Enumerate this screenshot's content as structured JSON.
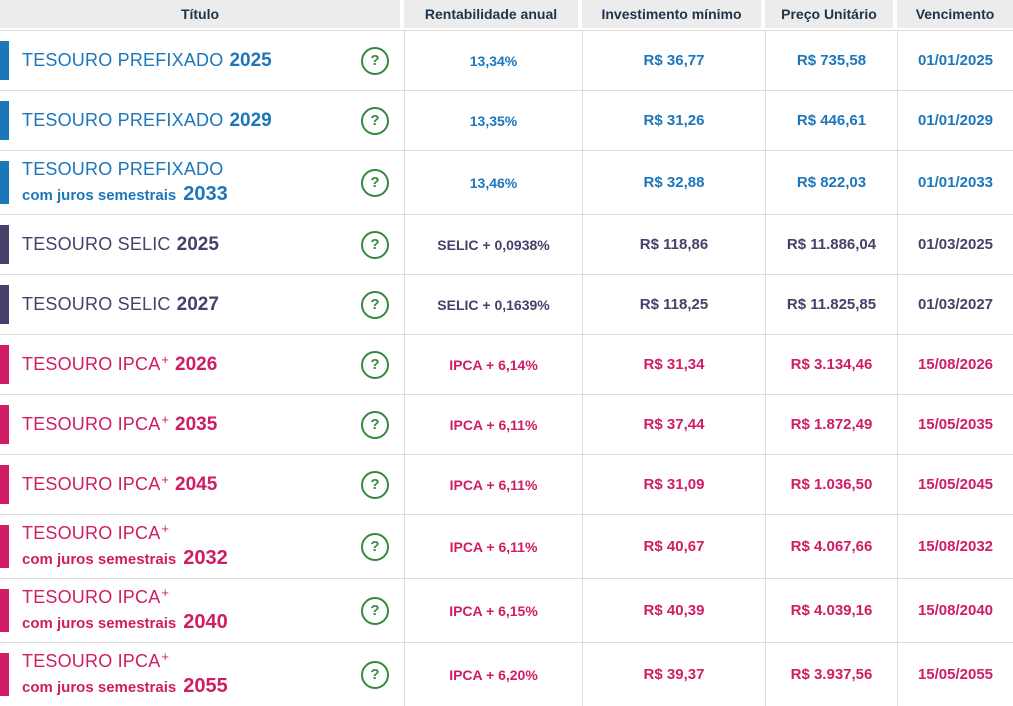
{
  "help_label": "?",
  "colors": {
    "prefixado": "#1c76ba",
    "selic": "#46406a",
    "ipca": "#d01c64",
    "help_green": "#37883f",
    "header_bg": "#ececec",
    "header_text": "#1f3449",
    "grid_border": "#dcdcdc"
  },
  "header": {
    "columns": [
      "Título",
      "Rentabilidade anual",
      "Investimento mínimo",
      "Preço Unitário",
      "Vencimento"
    ]
  },
  "rows": [
    {
      "family": "prefixado",
      "name": "TESOURO PREFIXADO",
      "sup": "",
      "subtitle": "",
      "year": "2025",
      "rate": "13,34%",
      "min_investment": "R$ 36,77",
      "unit_price": "R$ 735,58",
      "maturity": "01/01/2025"
    },
    {
      "family": "prefixado",
      "name": "TESOURO PREFIXADO",
      "sup": "",
      "subtitle": "",
      "year": "2029",
      "rate": "13,35%",
      "min_investment": "R$ 31,26",
      "unit_price": "R$ 446,61",
      "maturity": "01/01/2029"
    },
    {
      "family": "prefixado",
      "name": "TESOURO PREFIXADO",
      "sup": "",
      "subtitle": "com juros semestrais",
      "year": "2033",
      "rate": "13,46%",
      "min_investment": "R$ 32,88",
      "unit_price": "R$ 822,03",
      "maturity": "01/01/2033"
    },
    {
      "family": "selic",
      "name": "TESOURO SELIC",
      "sup": "",
      "subtitle": "",
      "year": "2025",
      "rate": "SELIC + 0,0938%",
      "min_investment": "R$ 118,86",
      "unit_price": "R$ 11.886,04",
      "maturity": "01/03/2025"
    },
    {
      "family": "selic",
      "name": "TESOURO SELIC",
      "sup": "",
      "subtitle": "",
      "year": "2027",
      "rate": "SELIC + 0,1639%",
      "min_investment": "R$ 118,25",
      "unit_price": "R$ 11.825,85",
      "maturity": "01/03/2027"
    },
    {
      "family": "ipca",
      "name": "TESOURO IPCA",
      "sup": "+",
      "subtitle": "",
      "year": "2026",
      "rate": "IPCA + 6,14%",
      "min_investment": "R$ 31,34",
      "unit_price": "R$ 3.134,46",
      "maturity": "15/08/2026"
    },
    {
      "family": "ipca",
      "name": "TESOURO IPCA",
      "sup": "+",
      "subtitle": "",
      "year": "2035",
      "rate": "IPCA + 6,11%",
      "min_investment": "R$ 37,44",
      "unit_price": "R$ 1.872,49",
      "maturity": "15/05/2035"
    },
    {
      "family": "ipca",
      "name": "TESOURO IPCA",
      "sup": "+",
      "subtitle": "",
      "year": "2045",
      "rate": "IPCA + 6,11%",
      "min_investment": "R$ 31,09",
      "unit_price": "R$ 1.036,50",
      "maturity": "15/05/2045"
    },
    {
      "family": "ipca",
      "name": "TESOURO IPCA",
      "sup": "+",
      "subtitle": "com juros semestrais",
      "year": "2032",
      "rate": "IPCA + 6,11%",
      "min_investment": "R$ 40,67",
      "unit_price": "R$ 4.067,66",
      "maturity": "15/08/2032"
    },
    {
      "family": "ipca",
      "name": "TESOURO IPCA",
      "sup": "+",
      "subtitle": "com juros semestrais",
      "year": "2040",
      "rate": "IPCA + 6,15%",
      "min_investment": "R$ 40,39",
      "unit_price": "R$ 4.039,16",
      "maturity": "15/08/2040"
    },
    {
      "family": "ipca",
      "name": "TESOURO IPCA",
      "sup": "+",
      "subtitle": "com juros semestrais",
      "year": "2055",
      "rate": "IPCA + 6,20%",
      "min_investment": "R$ 39,37",
      "unit_price": "R$ 3.937,56",
      "maturity": "15/05/2055"
    }
  ]
}
